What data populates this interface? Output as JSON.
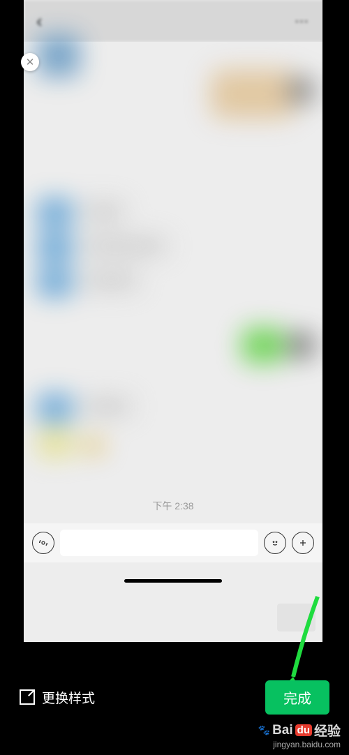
{
  "preview": {
    "timestamp": "下午 2:38"
  },
  "toolbar": {
    "change_style_label": "更换样式",
    "done_label": "完成"
  },
  "watermark": {
    "brand_prefix": "Bai",
    "brand_mid": "du",
    "brand_suffix": "经验",
    "url": "jingyan.baidu.com"
  }
}
